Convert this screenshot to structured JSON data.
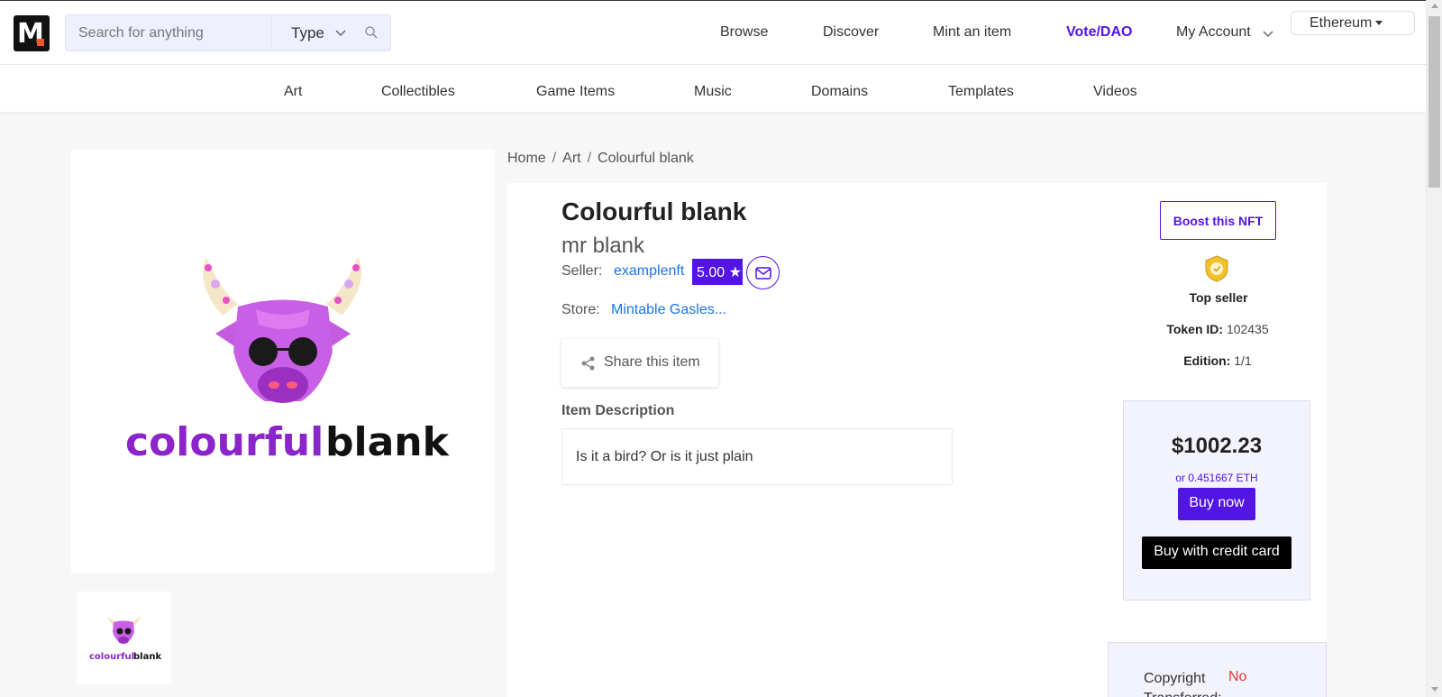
{
  "header": {
    "search_placeholder": "Search for anything",
    "type_label": "Type",
    "nav": {
      "browse": "Browse",
      "discover": "Discover",
      "mint": "Mint an item",
      "vote": "Vote/DAO",
      "account": "My Account"
    },
    "network": "Ethereum"
  },
  "categories": [
    "Art",
    "Collectibles",
    "Game Items",
    "Music",
    "Domains",
    "Templates",
    "Videos"
  ],
  "artwork": {
    "word1": "colourful",
    "word2": "blank"
  },
  "breadcrumb": [
    "Home",
    "Art",
    "Colourful blank"
  ],
  "item": {
    "title": "Colourful blank",
    "creator": "mr blank",
    "seller_label": "Seller:",
    "seller": "examplenft",
    "rating": "5.00",
    "store_label": "Store:",
    "store": "Mintable Gasles...",
    "share_label": "Share this item",
    "description_heading": "Item Description",
    "description": "Is it a bird? Or is it just plain"
  },
  "sidebar": {
    "boost_label": "Boost this NFT",
    "top_seller": "Top seller",
    "token_label": "Token ID:",
    "token_id": "102435",
    "edition_label": "Edition:",
    "edition": "1/1",
    "price": "$1002.23",
    "eth_price": "or 0.451667 ETH",
    "buy_now": "Buy now",
    "buy_card": "Buy with credit card",
    "copyright_label": "Copyright Transferred:",
    "copyright_value": "No"
  },
  "colors": {
    "brand": "#5314e6",
    "link": "#1a73e8",
    "negative": "#e53935"
  }
}
